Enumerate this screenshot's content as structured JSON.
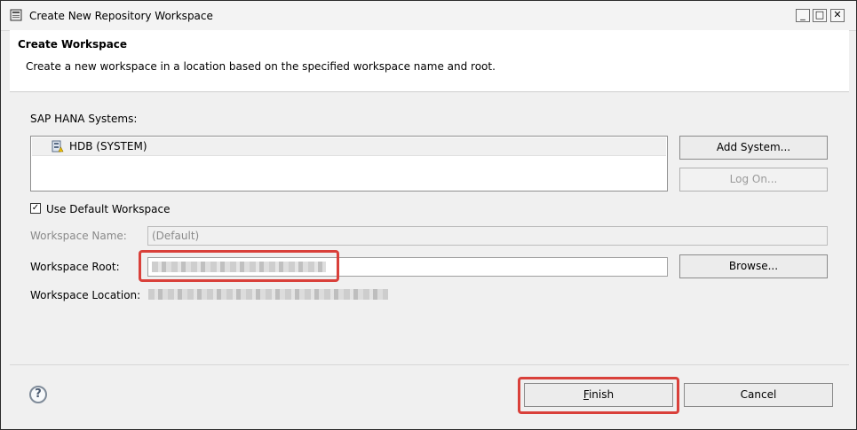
{
  "window": {
    "title": "Create New Repository Workspace",
    "buttons": {
      "minimize": "_",
      "maximize": "□",
      "close": "✕"
    }
  },
  "header": {
    "title": "Create Workspace",
    "description": "Create a new workspace in a location based on the specified workspace name and root."
  },
  "systems": {
    "label": "SAP HANA Systems:",
    "items": [
      {
        "label": "HDB (SYSTEM)",
        "icon": "database-system-icon"
      }
    ],
    "add_button": "Add System...",
    "logon_button": "Log On..."
  },
  "use_default": {
    "label": "Use Default Workspace",
    "checked": true
  },
  "workspace_name": {
    "label": "Workspace Name:",
    "value": "(Default)"
  },
  "workspace_root": {
    "label": "Workspace Root:",
    "browse_button": "Browse..."
  },
  "workspace_location": {
    "label": "Workspace Location:"
  },
  "footer": {
    "help": "?",
    "finish_rest": "inish",
    "finish_mnemonic": "F",
    "cancel": "Cancel"
  },
  "colors": {
    "highlight": "#d9403a",
    "dialog_bg": "#f0f0f0"
  }
}
